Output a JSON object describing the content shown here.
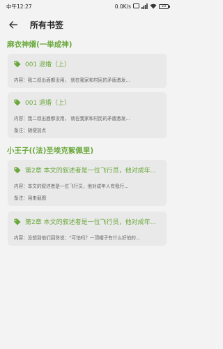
{
  "status": {
    "time": "中午12:27",
    "speed": "0.0K/s",
    "battery": "23"
  },
  "header": {
    "title": "所有书签"
  },
  "books": [
    {
      "title": "麻衣神婿(一举成神)",
      "bookmarks": [
        {
          "chapter": "001  退婚（上）",
          "content": "内容：我二叔出面都没用，        就在我家和村民的矛盾激发..."
        },
        {
          "chapter": "001  退婚（上）",
          "content": "内容：我二叔出面都没用，        就在我家和村民的矛盾激发...",
          "note": "备注：随便加点"
        }
      ]
    },
    {
      "title": "小王子((法)圣埃克絮佩里)",
      "bookmarks": [
        {
          "chapter": "第2章 本文的叙述者是一位飞行员，他对成年...",
          "content": "内容：本文的叙述者是一位飞行员，他对成年人有我行...",
          "note": "备注：用来截图"
        },
        {
          "chapter": "第2章 本文的叙述者是一位飞行员，他对成年...",
          "content": "内容：没想到他们回答说：“可怕吗？一顶帽子有什么好怕的..."
        }
      ]
    }
  ],
  "colors": {
    "accent": "#6aa83c",
    "card": "#e9e9e9",
    "background": "#f3f3f3"
  }
}
